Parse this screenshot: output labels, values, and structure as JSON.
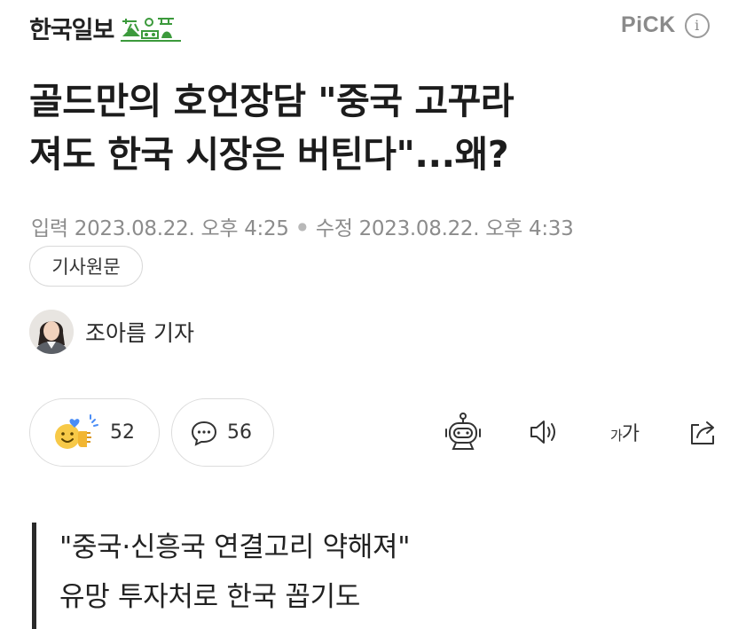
{
  "header": {
    "logo_text": "한국일보",
    "logo_mark_icon": "hankook-ilbo-mark-icon",
    "pick_label": "PiCK",
    "info_label": "i"
  },
  "article": {
    "title_line1": "골드만의 호언장담 \"중국 고꾸라",
    "title_line2": "져도 한국 시장은 버틴다\"...왜?",
    "published_label": "입력",
    "published_value": "2023.08.22. 오후 4:25",
    "modified_label": "수정",
    "modified_value": "2023.08.22. 오후 4:33",
    "original_button": "기사원문",
    "reporter": "조아름 기자"
  },
  "actions": {
    "like_count": "52",
    "comment_count": "56",
    "font_size_label_small": "가",
    "font_size_label_large": "가",
    "icons": [
      "smile-like-icon",
      "comment-icon",
      "robot-summary-icon",
      "speaker-icon",
      "font-size-icon",
      "share-icon"
    ]
  },
  "subheadline": {
    "line1": "\"중국·신흥국 연결고리 약해져\"",
    "line2": "유망 투자처로 한국 꼽기도"
  },
  "colors": {
    "logo_green": "#3c9a3c",
    "muted": "#8c8c8c",
    "like_yellow": "#f7c948",
    "like_blue": "#4a8df6"
  }
}
